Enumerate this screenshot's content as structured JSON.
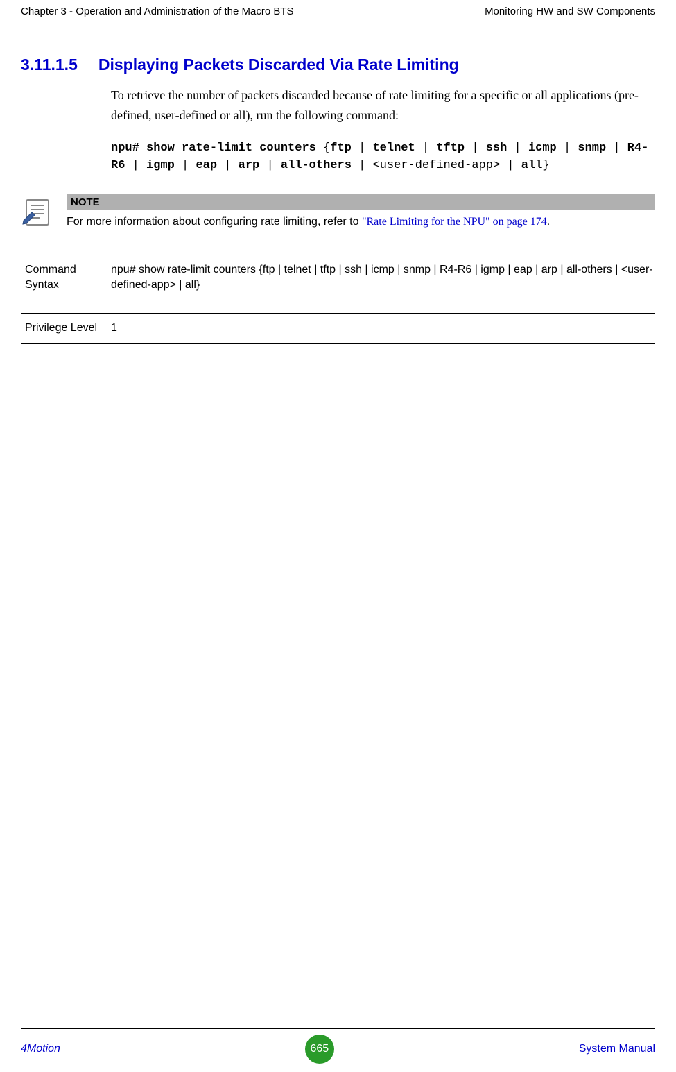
{
  "header": {
    "left": "Chapter 3 - Operation and Administration of the Macro BTS",
    "right": "Monitoring HW and SW Components"
  },
  "section": {
    "number": "3.11.1.5",
    "title": "Displaying Packets Discarded Via Rate Limiting"
  },
  "body": {
    "intro": "To retrieve the number of packets discarded because of rate limiting for a specific or all applications (pre-defined, user-defined or all), run the following command:"
  },
  "code": {
    "parts": [
      {
        "t": "npu# show rate-limit counters ",
        "b": true
      },
      {
        "t": "{",
        "b": false
      },
      {
        "t": "ftp",
        "b": true
      },
      {
        "t": " | ",
        "b": false
      },
      {
        "t": "telnet",
        "b": true
      },
      {
        "t": " | ",
        "b": false
      },
      {
        "t": "tftp",
        "b": true
      },
      {
        "t": " | ",
        "b": false
      },
      {
        "t": "ssh",
        "b": true
      },
      {
        "t": " | ",
        "b": false
      },
      {
        "t": "icmp",
        "b": true
      },
      {
        "t": " | ",
        "b": false
      },
      {
        "t": "snmp",
        "b": true
      },
      {
        "t": " | ",
        "b": false
      },
      {
        "t": "R4-R6",
        "b": true
      },
      {
        "t": " | ",
        "b": false
      },
      {
        "t": "igmp",
        "b": true
      },
      {
        "t": " | ",
        "b": false
      },
      {
        "t": "eap",
        "b": true
      },
      {
        "t": " | ",
        "b": false
      },
      {
        "t": "arp",
        "b": true
      },
      {
        "t": " | ",
        "b": false
      },
      {
        "t": "all-others",
        "b": true
      },
      {
        "t": " | <user-defined-app> | ",
        "b": false
      },
      {
        "t": "all",
        "b": true
      },
      {
        "t": "}",
        "b": false
      }
    ]
  },
  "note": {
    "label": "NOTE",
    "text_prefix": "For more information about configuring rate limiting, refer to ",
    "link": "\"Rate Limiting for the NPU\" on page 174",
    "text_suffix": "."
  },
  "table": {
    "rows": [
      {
        "label": "Command Syntax",
        "value": "npu# show rate-limit counters {ftp | telnet | tftp | ssh | icmp | snmp | R4-R6 | igmp | eap | arp | all-others | <user-defined-app> | all}"
      },
      {
        "label": "Privilege Level",
        "value": "1"
      }
    ]
  },
  "footer": {
    "left": "4Motion",
    "page": "665",
    "right": "System Manual"
  }
}
